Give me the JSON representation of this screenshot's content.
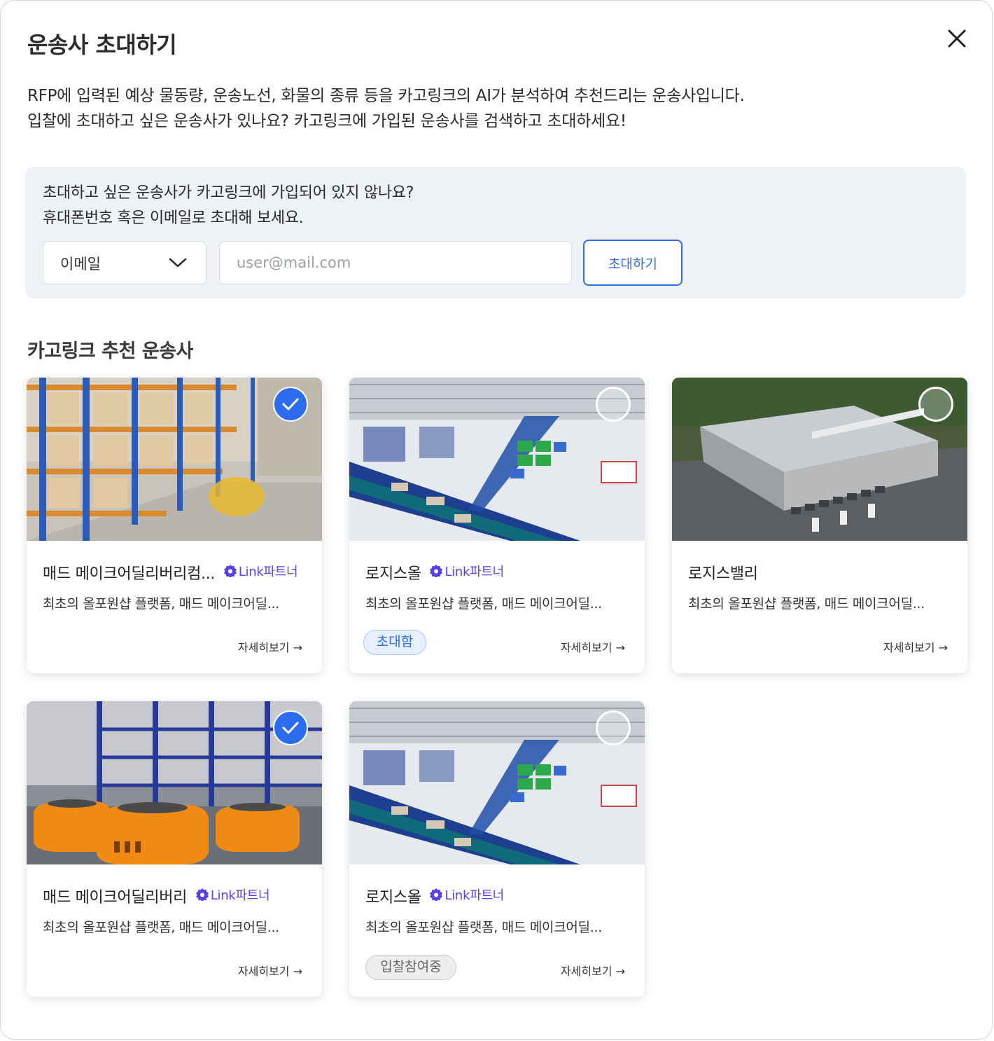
{
  "modal": {
    "title": "운송사 초대하기",
    "description_line1": "RFP에 입력된 예상 물동량, 운송노선, 화물의 종류 등을 카고링크의 AI가 분석하여 추천드리는 운송사입니다.",
    "description_line2": "입찰에 초대하고 싶은 운송사가 있나요? 카고링크에 가입된 운송사를 검색하고 초대하세요!",
    "close_icon": "close-icon"
  },
  "invite": {
    "text_line1": "초대하고 싶은 운송사가 카고링크에 가입되어 있지 않나요?",
    "text_line2": "휴대폰번호 혹은 이메일로 초대해 보세요.",
    "select_value": "이메일",
    "input_placeholder": "user@mail.com",
    "input_value": "",
    "button_label": "초대하기"
  },
  "section_title": "카고링크 추천 운송사",
  "partner_label": "Link파트너",
  "detail_label": "자세히보기 →",
  "colors": {
    "accent": "#2d6cf0",
    "partner": "#5b3ee6",
    "invite_bg": "#eef1f5"
  },
  "cards": [
    {
      "name": "매드 메이크어딜리버리컴...",
      "partner": true,
      "desc": "최초의 올포원샵 플랫폼, 매드 메이크어딜...",
      "selected": true,
      "tag": "",
      "image": "warehouse-racks"
    },
    {
      "name": "로지스올",
      "partner": true,
      "desc": "최초의 올포원샵 플랫폼, 매드 메이크어딜...",
      "selected": false,
      "tag": "초대함",
      "image": "conveyor-warehouse"
    },
    {
      "name": "로지스밸리",
      "partner": false,
      "desc": "최초의 올포원샵 플랫폼, 매드 메이크어딜...",
      "selected": false,
      "tag": "",
      "image": "logistics-building"
    },
    {
      "name": "매드 메이크어딜리버리",
      "partner": true,
      "desc": "최초의 올포원샵 플랫폼, 매드 메이크어딜...",
      "selected": true,
      "tag": "",
      "image": "orange-robots"
    },
    {
      "name": "로지스올",
      "partner": true,
      "desc": "최초의 올포원샵 플랫폼, 매드 메이크어딜...",
      "selected": false,
      "tag": "입찰참여중",
      "image": "conveyor-warehouse"
    }
  ]
}
